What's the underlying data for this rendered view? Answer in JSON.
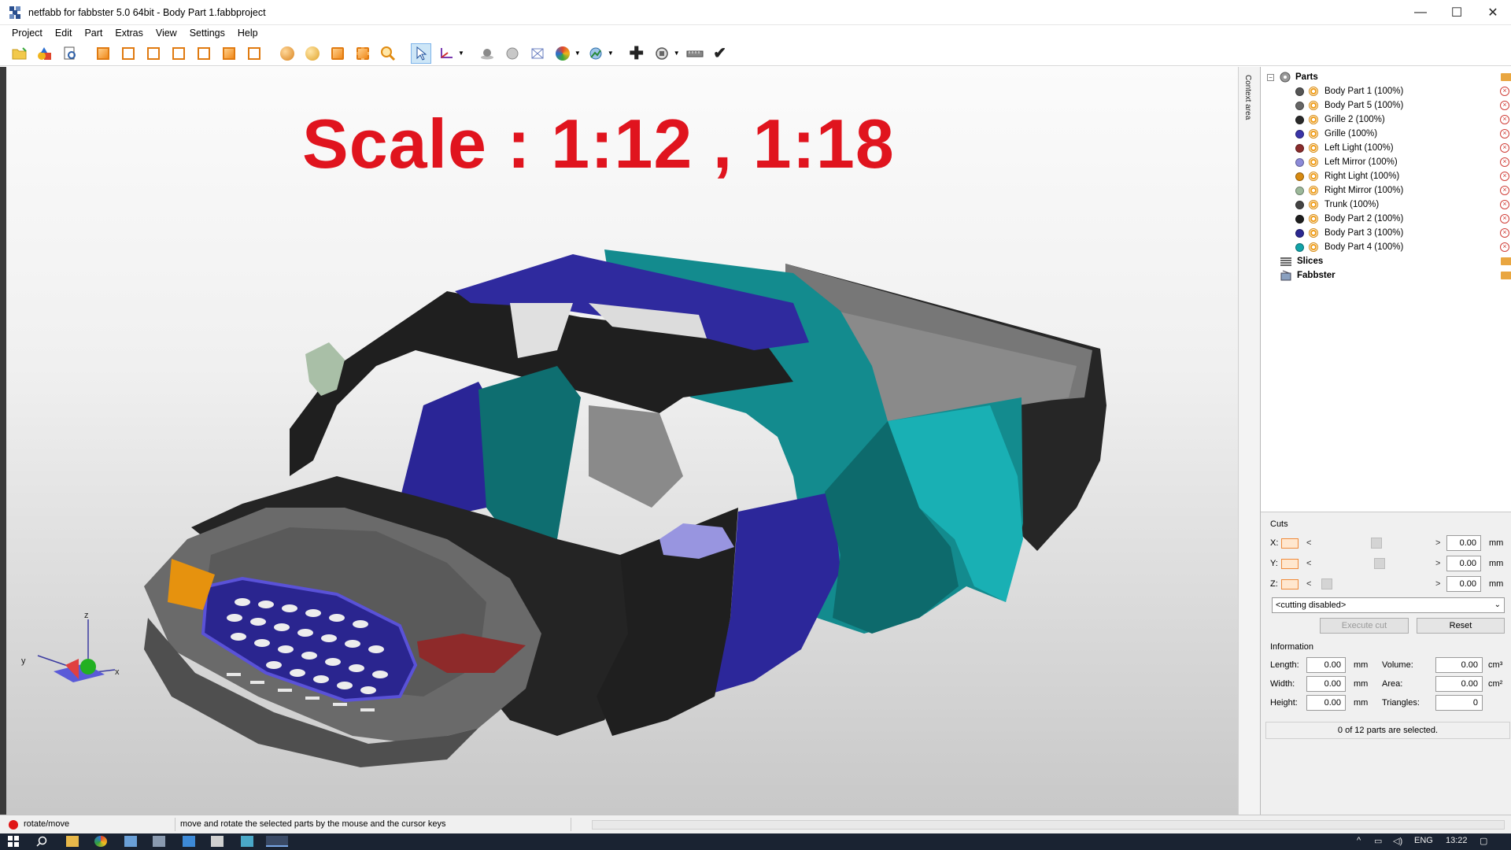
{
  "window": {
    "title": "netfabb for fabbster 5.0 64bit - Body Part 1.fabbproject",
    "minimize": "—",
    "maximize": "☐",
    "close": "✕"
  },
  "menu": [
    "Project",
    "Edit",
    "Part",
    "Extras",
    "View",
    "Settings",
    "Help"
  ],
  "viewport": {
    "overlay_text": "Scale : 1:12 , 1:18",
    "context_area_label": "Context area",
    "axis": {
      "x": "x",
      "y": "y",
      "z": "z"
    }
  },
  "tree": {
    "root": "Parts",
    "parts": [
      {
        "label": "Body Part 1 (100%)",
        "color": "#555555"
      },
      {
        "label": "Body Part 5 (100%)",
        "color": "#666666"
      },
      {
        "label": "Grille 2 (100%)",
        "color": "#2a2a2a"
      },
      {
        "label": "Grille (100%)",
        "color": "#3a34a8"
      },
      {
        "label": "Left Light (100%)",
        "color": "#8a2c2c"
      },
      {
        "label": "Left Mirror (100%)",
        "color": "#8c8ad8"
      },
      {
        "label": "Right Light (100%)",
        "color": "#d78a10"
      },
      {
        "label": "Right Mirror (100%)",
        "color": "#9cb89a"
      },
      {
        "label": "Trunk (100%)",
        "color": "#444444"
      },
      {
        "label": "Body Part 2 (100%)",
        "color": "#1e1e1e"
      },
      {
        "label": "Body Part 3 (100%)",
        "color": "#2b2891"
      },
      {
        "label": "Body Part 4 (100%)",
        "color": "#12a3a8"
      }
    ],
    "slices": "Slices",
    "fabbster": "Fabbster"
  },
  "cuts": {
    "title": "Cuts",
    "rows": [
      {
        "axis": "X:",
        "value": "0.00",
        "unit": "mm",
        "thumb": 0.5
      },
      {
        "axis": "Y:",
        "value": "0.00",
        "unit": "mm",
        "thumb": 0.53
      },
      {
        "axis": "Z:",
        "value": "0.00",
        "unit": "mm",
        "thumb": 0.08
      }
    ],
    "lt": "<",
    "gt": ">",
    "mode": "<cutting disabled>",
    "execute": "Execute cut",
    "reset": "Reset"
  },
  "information": {
    "title": "Information",
    "length_label": "Length:",
    "length": "0.00",
    "length_unit": "mm",
    "width_label": "Width:",
    "width": "0.00",
    "width_unit": "mm",
    "height_label": "Height:",
    "height": "0.00",
    "height_unit": "mm",
    "volume_label": "Volume:",
    "volume": "0.00",
    "volume_unit": "cm³",
    "area_label": "Area:",
    "area": "0.00",
    "area_unit": "cm²",
    "triangles_label": "Triangles:",
    "triangles": "0"
  },
  "selection": "0 of 12 parts are selected.",
  "status": {
    "mode": "rotate/move",
    "hint": "move and rotate the selected parts by the mouse and the cursor keys"
  },
  "taskbar": {
    "lang": "ENG",
    "time": "13:22"
  }
}
